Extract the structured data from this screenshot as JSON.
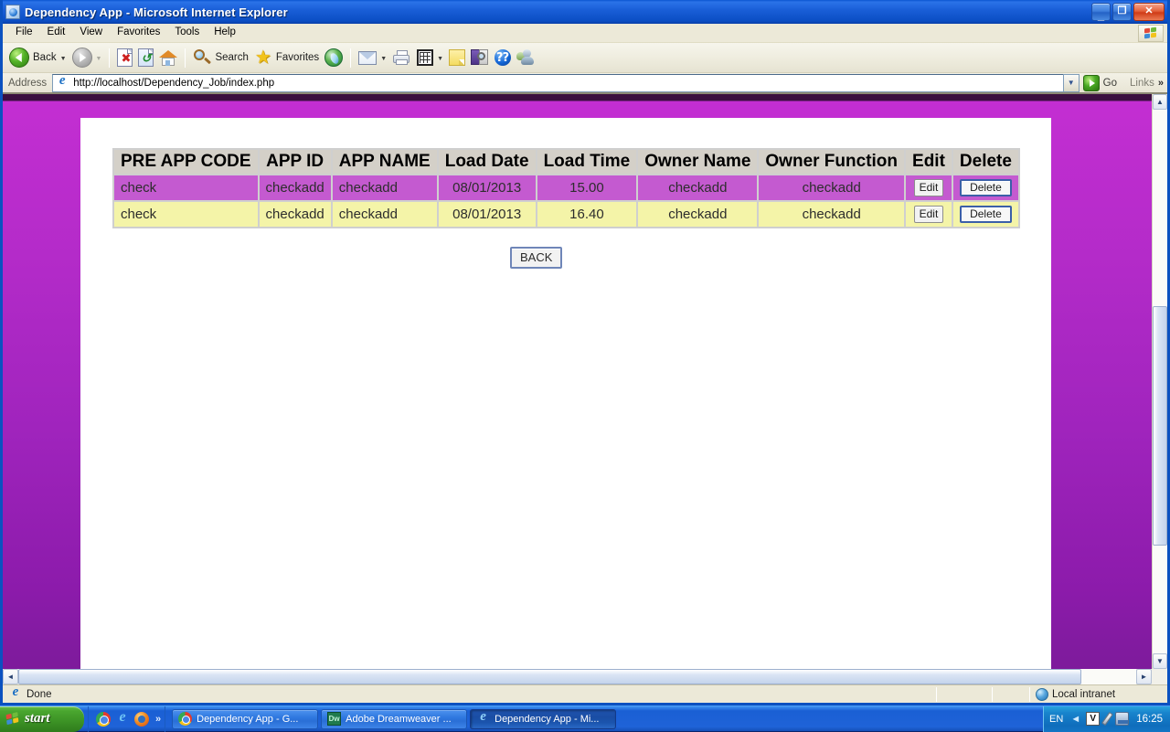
{
  "window": {
    "title": "Dependency App - Microsoft Internet Explorer",
    "icon": "ie-document-icon",
    "minimize_label": "_",
    "maximize_label": "❐",
    "close_label": "✕"
  },
  "menubar": {
    "items": [
      {
        "label": "File"
      },
      {
        "label": "Edit"
      },
      {
        "label": "View"
      },
      {
        "label": "Favorites"
      },
      {
        "label": "Tools"
      },
      {
        "label": "Help"
      }
    ],
    "logo_icon": "windows-flag-icon"
  },
  "toolbar": {
    "back_label": "Back",
    "back_icon": "back-arrow-icon",
    "forward_icon": "forward-arrow-icon",
    "stop_icon": "stop-icon",
    "refresh_icon": "refresh-icon",
    "home_icon": "home-icon",
    "search_label": "Search",
    "search_icon": "search-icon",
    "favorites_label": "Favorites",
    "favorites_icon": "star-icon",
    "media_icon": "media-icon",
    "mail_icon": "mail-icon",
    "print_icon": "print-icon",
    "edit_icon": "edit-grid-icon",
    "notes_icon": "note-icon",
    "research_icon": "research-book-icon",
    "bluetooth_icon": "bluetooth-icon",
    "messenger_icon": "messenger-users-icon",
    "dropdown_caret": "▼"
  },
  "address_bar": {
    "label": "Address",
    "url": "http://localhost/Dependency_Job/index.php",
    "page_icon": "ie-page-icon",
    "dropdown_icon": "chevron-down-icon",
    "go_label": "Go",
    "go_icon": "go-arrow-icon",
    "links_label": "Links",
    "links_chevron": "»"
  },
  "page": {
    "background_top_color": "#c32ed2",
    "background_bottom_color": "#7d1b9b",
    "card_background": "#ffffff",
    "table": {
      "headers": [
        "PRE APP CODE",
        "APP ID",
        "APP NAME",
        "Load Date",
        "Load Time",
        "Owner Name",
        "Owner Function",
        "Edit",
        "Delete"
      ],
      "header_background": "#d4d0c8",
      "row_odd_background": "#c45ad0",
      "row_even_background": "#f4f4a8",
      "rows": [
        {
          "pre_app_code": "check",
          "app_id": "checkadd",
          "app_name": "checkadd",
          "load_date": "08/01/2013",
          "load_time": "15.00",
          "owner_name": "checkadd",
          "owner_function": "checkadd",
          "edit_label": "Edit",
          "delete_label": "Delete"
        },
        {
          "pre_app_code": "check",
          "app_id": "checkadd",
          "app_name": "checkadd",
          "load_date": "08/01/2013",
          "load_time": "16.40",
          "owner_name": "checkadd",
          "owner_function": "checkadd",
          "edit_label": "Edit",
          "delete_label": "Delete"
        }
      ]
    },
    "back_button_label": "BACK"
  },
  "scrollbars": {
    "up_arrow": "▲",
    "down_arrow": "▼",
    "left_arrow": "◄",
    "right_arrow": "►"
  },
  "statusbar": {
    "status_text": "Done",
    "status_icon": "ie-page-icon",
    "zone_text": "Local intranet",
    "zone_icon": "globe-icon"
  },
  "taskbar": {
    "start_label": "start",
    "start_icon": "windows-flag-icon",
    "quicklaunch": [
      {
        "icon": "chrome-icon"
      },
      {
        "icon": "internet-explorer-icon"
      },
      {
        "icon": "firefox-icon"
      }
    ],
    "quicklaunch_chevron": "»",
    "tasks": [
      {
        "label": "Dependency App - G...",
        "icon": "chrome-icon",
        "active": false
      },
      {
        "label": "Adobe Dreamweaver ...",
        "icon": "dreamweaver-icon",
        "icon_text": "Dw",
        "active": false
      },
      {
        "label": "Dependency App - Mi...",
        "icon": "internet-explorer-icon",
        "active": true
      }
    ],
    "tray": {
      "language": "EN",
      "chevron": "◄",
      "icons": [
        {
          "icon": "volume-v-icon",
          "glyph": "V"
        },
        {
          "icon": "pen-input-icon"
        },
        {
          "icon": "network-icon"
        }
      ],
      "clock": "16:25"
    }
  }
}
